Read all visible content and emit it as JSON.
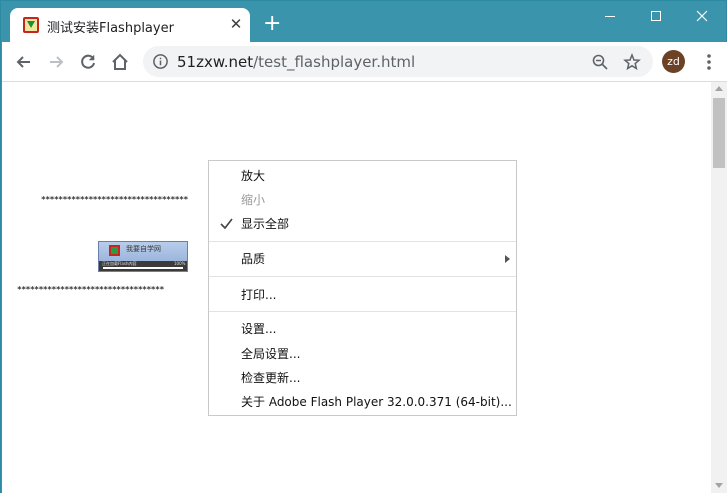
{
  "browser": {
    "tab_title": "测试安装Flashplayer",
    "tab_close_icon": "close-icon",
    "new_tab_label": "+",
    "url_host": "51zxw.net",
    "url_path": "/test_flashplayer.html",
    "avatar_initials": "zd",
    "frame_color": "#3a95ac",
    "avatar_color": "#6b4226"
  },
  "page": {
    "dots_line_1": "**********************************",
    "dots_line_2": "**********************************",
    "flash_banner": {
      "title": "我要自学网",
      "status": "正在加载Flash内容",
      "percent": "100%"
    }
  },
  "context_menu": {
    "items": [
      {
        "label": "放大",
        "enabled": true,
        "checked": false
      },
      {
        "label": "缩小",
        "enabled": false,
        "checked": false
      },
      {
        "label": "显示全部",
        "enabled": true,
        "checked": true
      },
      {
        "label": "品质",
        "enabled": true,
        "submenu": true
      },
      {
        "label": "打印...",
        "enabled": true
      },
      {
        "label": "设置...",
        "enabled": true
      },
      {
        "label": "全局设置...",
        "enabled": true
      },
      {
        "label": "检查更新...",
        "enabled": true
      },
      {
        "label": "关于 Adobe Flash Player 32.0.0.371 (64-bit)...",
        "enabled": true
      }
    ]
  }
}
